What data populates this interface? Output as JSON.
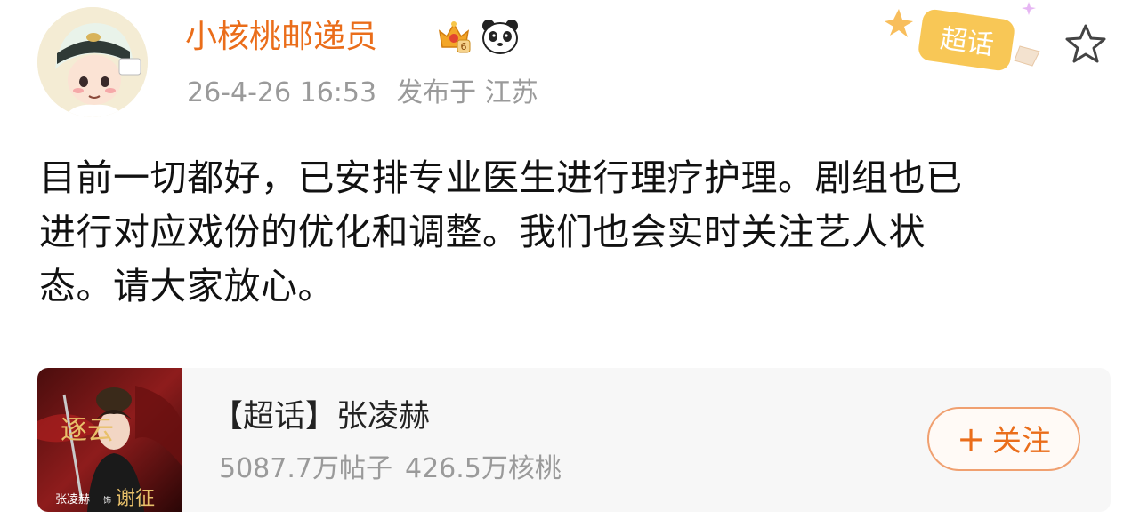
{
  "post": {
    "author": {
      "name": "小核桃邮递员",
      "badge_level": "6"
    },
    "timestamp": "26-4-26 16:53",
    "location": "发布于 江苏",
    "lines": [
      "目前一切都好，已安排专业医生进行理疗护理。剧组也已",
      "进行对应戏份的优化和调整。我们也会实时关注艺人状",
      "态。请大家放心。"
    ],
    "tag_badge": "超话"
  },
  "card": {
    "title": "【超话】张凌赫",
    "posts_count": "5087.7万帖子",
    "walnut_count": "426.5万核桃",
    "follow_plus": "+",
    "follow_label": "关注",
    "cover": {
      "title_chars": "逐云",
      "actor_name": "张凌赫",
      "role_label": "饰",
      "role_name": "谢征"
    }
  },
  "colors": {
    "accent": "#ea6d1a",
    "text": "#111111",
    "muted": "#9a9a9a",
    "card_bg": "#f7f7f7"
  },
  "icons": [
    "avatar",
    "crown-badge-icon",
    "panda-icon",
    "chaohua-badge-icon",
    "star-icon"
  ]
}
